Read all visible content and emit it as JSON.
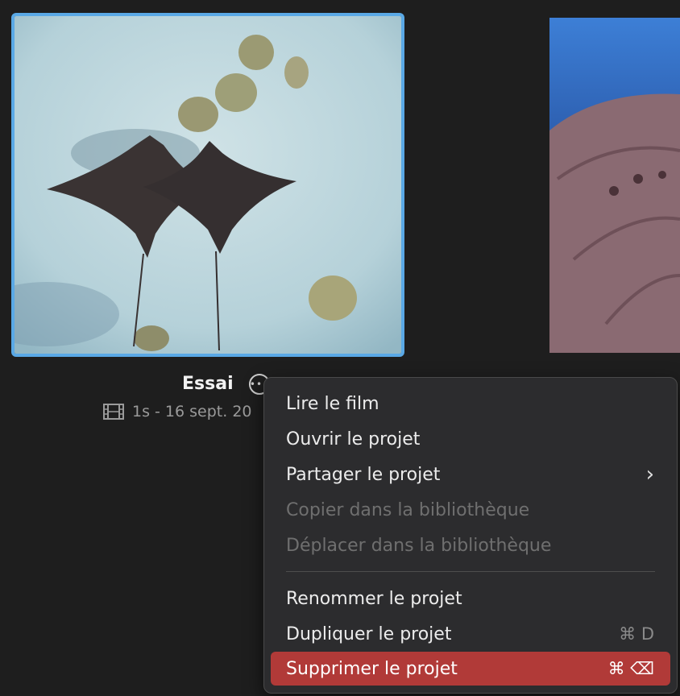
{
  "project": {
    "title": "Essai",
    "meta": "1s - 16 sept. 20",
    "more_icon": "ellipsis-circle-icon",
    "film_icon": "film-strip-icon"
  },
  "menu": {
    "items": [
      {
        "label": "Lire le film"
      },
      {
        "label": "Ouvrir le projet"
      },
      {
        "label": "Partager le projet",
        "submenu_icon": "chevron-right-icon"
      },
      {
        "label": "Copier dans la bibliothèque",
        "disabled": true
      },
      {
        "label": "Déplacer dans la bibliothèque",
        "disabled": true
      },
      {
        "label": "Renommer le projet"
      },
      {
        "label": "Dupliquer le projet",
        "shortcut": "⌘ D"
      },
      {
        "label": "Supprimer le projet",
        "shortcut": "⌘ ⌫",
        "highlighted": true
      }
    ]
  },
  "colors": {
    "selection_border": "#5aa9e6",
    "danger_highlight": "#b13a38",
    "background": "#1e1e1e"
  }
}
